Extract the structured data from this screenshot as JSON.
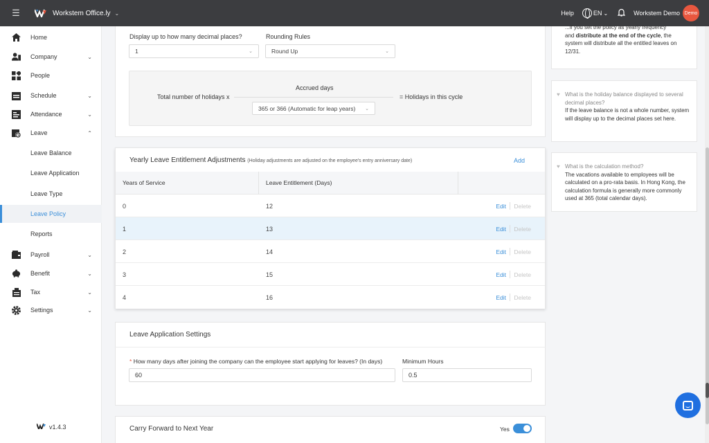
{
  "topbar": {
    "brand": "Workstem Office.ly",
    "help": "Help",
    "lang": "EN",
    "user": "Workstem Demo",
    "avatar": "Demo"
  },
  "sidebar": {
    "items": [
      {
        "label": "Home",
        "icon": "home-icon"
      },
      {
        "label": "Company",
        "icon": "company-icon",
        "caret": "⌄"
      },
      {
        "label": "People",
        "icon": "people-icon"
      },
      {
        "label": "Schedule",
        "icon": "schedule-icon",
        "caret": "⌄"
      },
      {
        "label": "Attendance",
        "icon": "attendance-icon",
        "caret": "⌄"
      },
      {
        "label": "Leave",
        "icon": "leave-icon",
        "caret": "⌃"
      },
      {
        "label": "Leave Balance"
      },
      {
        "label": "Leave Application"
      },
      {
        "label": "Leave Type"
      },
      {
        "label": "Leave Policy",
        "active": true
      },
      {
        "label": "Reports"
      },
      {
        "label": "Payroll",
        "icon": "payroll-icon",
        "caret": "⌄"
      },
      {
        "label": "Benefit",
        "icon": "benefit-icon",
        "caret": "⌄"
      },
      {
        "label": "Tax",
        "icon": "tax-icon",
        "caret": "⌄"
      },
      {
        "label": "Settings",
        "icon": "settings-icon",
        "caret": "⌄"
      }
    ],
    "version": "v1.4.3"
  },
  "decimal": {
    "label": "Display up to how many decimal places?",
    "value": "1",
    "rounding_label": "Rounding Rules",
    "rounding_value": "Round Up"
  },
  "formula": {
    "left": "Total number of holidays x",
    "top": "Accrued days",
    "select": "365 or 366 (Automatic for leap years)",
    "right": "= Holidays in this cycle"
  },
  "adjustments": {
    "title": "Yearly Leave Entitlement Adjustments",
    "note": "(Holiday adjustments are adjusted on the employee's entry anniversary date)",
    "add": "Add",
    "col_years": "Years of Service",
    "col_entitlement": "Leave Entitlement (Days)",
    "edit": "Edit",
    "delete": "Delete",
    "rows": [
      {
        "years": "0",
        "days": "12"
      },
      {
        "years": "1",
        "days": "13"
      },
      {
        "years": "2",
        "days": "14"
      },
      {
        "years": "3",
        "days": "15"
      },
      {
        "years": "4",
        "days": "16"
      }
    ]
  },
  "application": {
    "title": "Leave Application Settings",
    "required_mark": "*",
    "days_label": "How many days after joining the company can the employee start applying for leaves? (In days)",
    "days_value": "60",
    "hours_label": "Minimum Hours",
    "hours_value": "0.5"
  },
  "carry": {
    "title": "Carry Forward to Next Year",
    "toggle_label": "Yes"
  },
  "help_panel": {
    "card1_line1": "...if you set the policy as yearly frequency",
    "card1_line2_bold": "distribute at the end of the cycle",
    "card1_line2_pre": "and ",
    "card1_line2_post": ", the",
    "card1_line3": "system will distribute all the entitled leaves on",
    "card1_line4": "12/31.",
    "card2_q": "What is the holiday balance displayed to several decimal places?",
    "card2_a": "If the leave balance is not a whole number, system will display up to the decimal places set here.",
    "card3_q": "What is the calculation method?",
    "card3_a": "The vacations available to employees will be calculated on a pro-rata basis. In Hong Kong, the calculation formula is generally more commonly used at 365 (total calendar days)."
  },
  "colors": {
    "accent": "#3b8fd9",
    "topbar": "#3c3d40",
    "avatar": "#e8573f",
    "chat": "#1f6fe0"
  }
}
